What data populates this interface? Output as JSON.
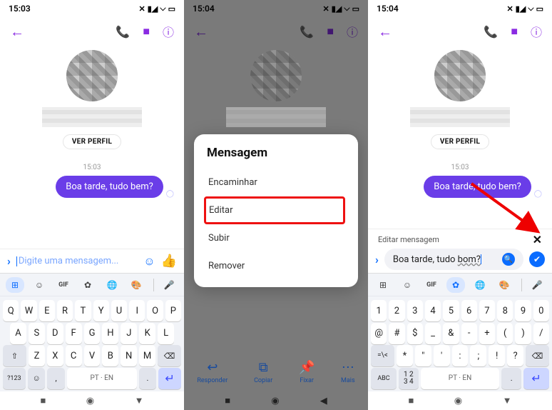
{
  "s1": {
    "time": "15:03",
    "profile_btn": "VER PERFIL",
    "ts": "15:03",
    "bubble": "Boa tarde, tudo bem?",
    "placeholder": "Digite uma mensagem...",
    "gif": "GIF",
    "space": "PT · EN",
    "numkey": "?123",
    "row1": [
      "Q",
      "W",
      "E",
      "R",
      "T",
      "Y",
      "U",
      "I",
      "O",
      "P"
    ],
    "row2": [
      "A",
      "S",
      "D",
      "F",
      "G",
      "H",
      "J",
      "K",
      "L"
    ],
    "row3": [
      "Z",
      "X",
      "C",
      "V",
      "B",
      "N",
      "M"
    ]
  },
  "s2": {
    "time": "15:04",
    "modal_title": "Mensagem",
    "opts": [
      "Encaminhar",
      "Editar",
      "Subir",
      "Remover"
    ],
    "quick": [
      "Responder",
      "Copiar",
      "Fixar",
      "Mais"
    ]
  },
  "s3": {
    "time": "15:04",
    "profile_btn": "VER PERFIL",
    "ts": "15:03",
    "bubble": "Boa tarde, tudo bem?",
    "edit_title": "Editar mensagem",
    "edit_value": "Boa tarde, tudo ",
    "edit_ul": "bom?",
    "gif": "GIF",
    "abc": "ABC",
    "frac": "12\n34",
    "space": "PT · EN",
    "row1": [
      "1",
      "2",
      "3",
      "4",
      "5",
      "6",
      "7",
      "8",
      "9",
      "0"
    ],
    "row2": [
      "@",
      "#",
      "$",
      "_",
      "&",
      "-",
      "+",
      "(",
      ")",
      "/"
    ],
    "row3": [
      "*",
      "\"",
      "'",
      ":",
      ";",
      "!",
      "?"
    ],
    "sym": "=\\<"
  }
}
